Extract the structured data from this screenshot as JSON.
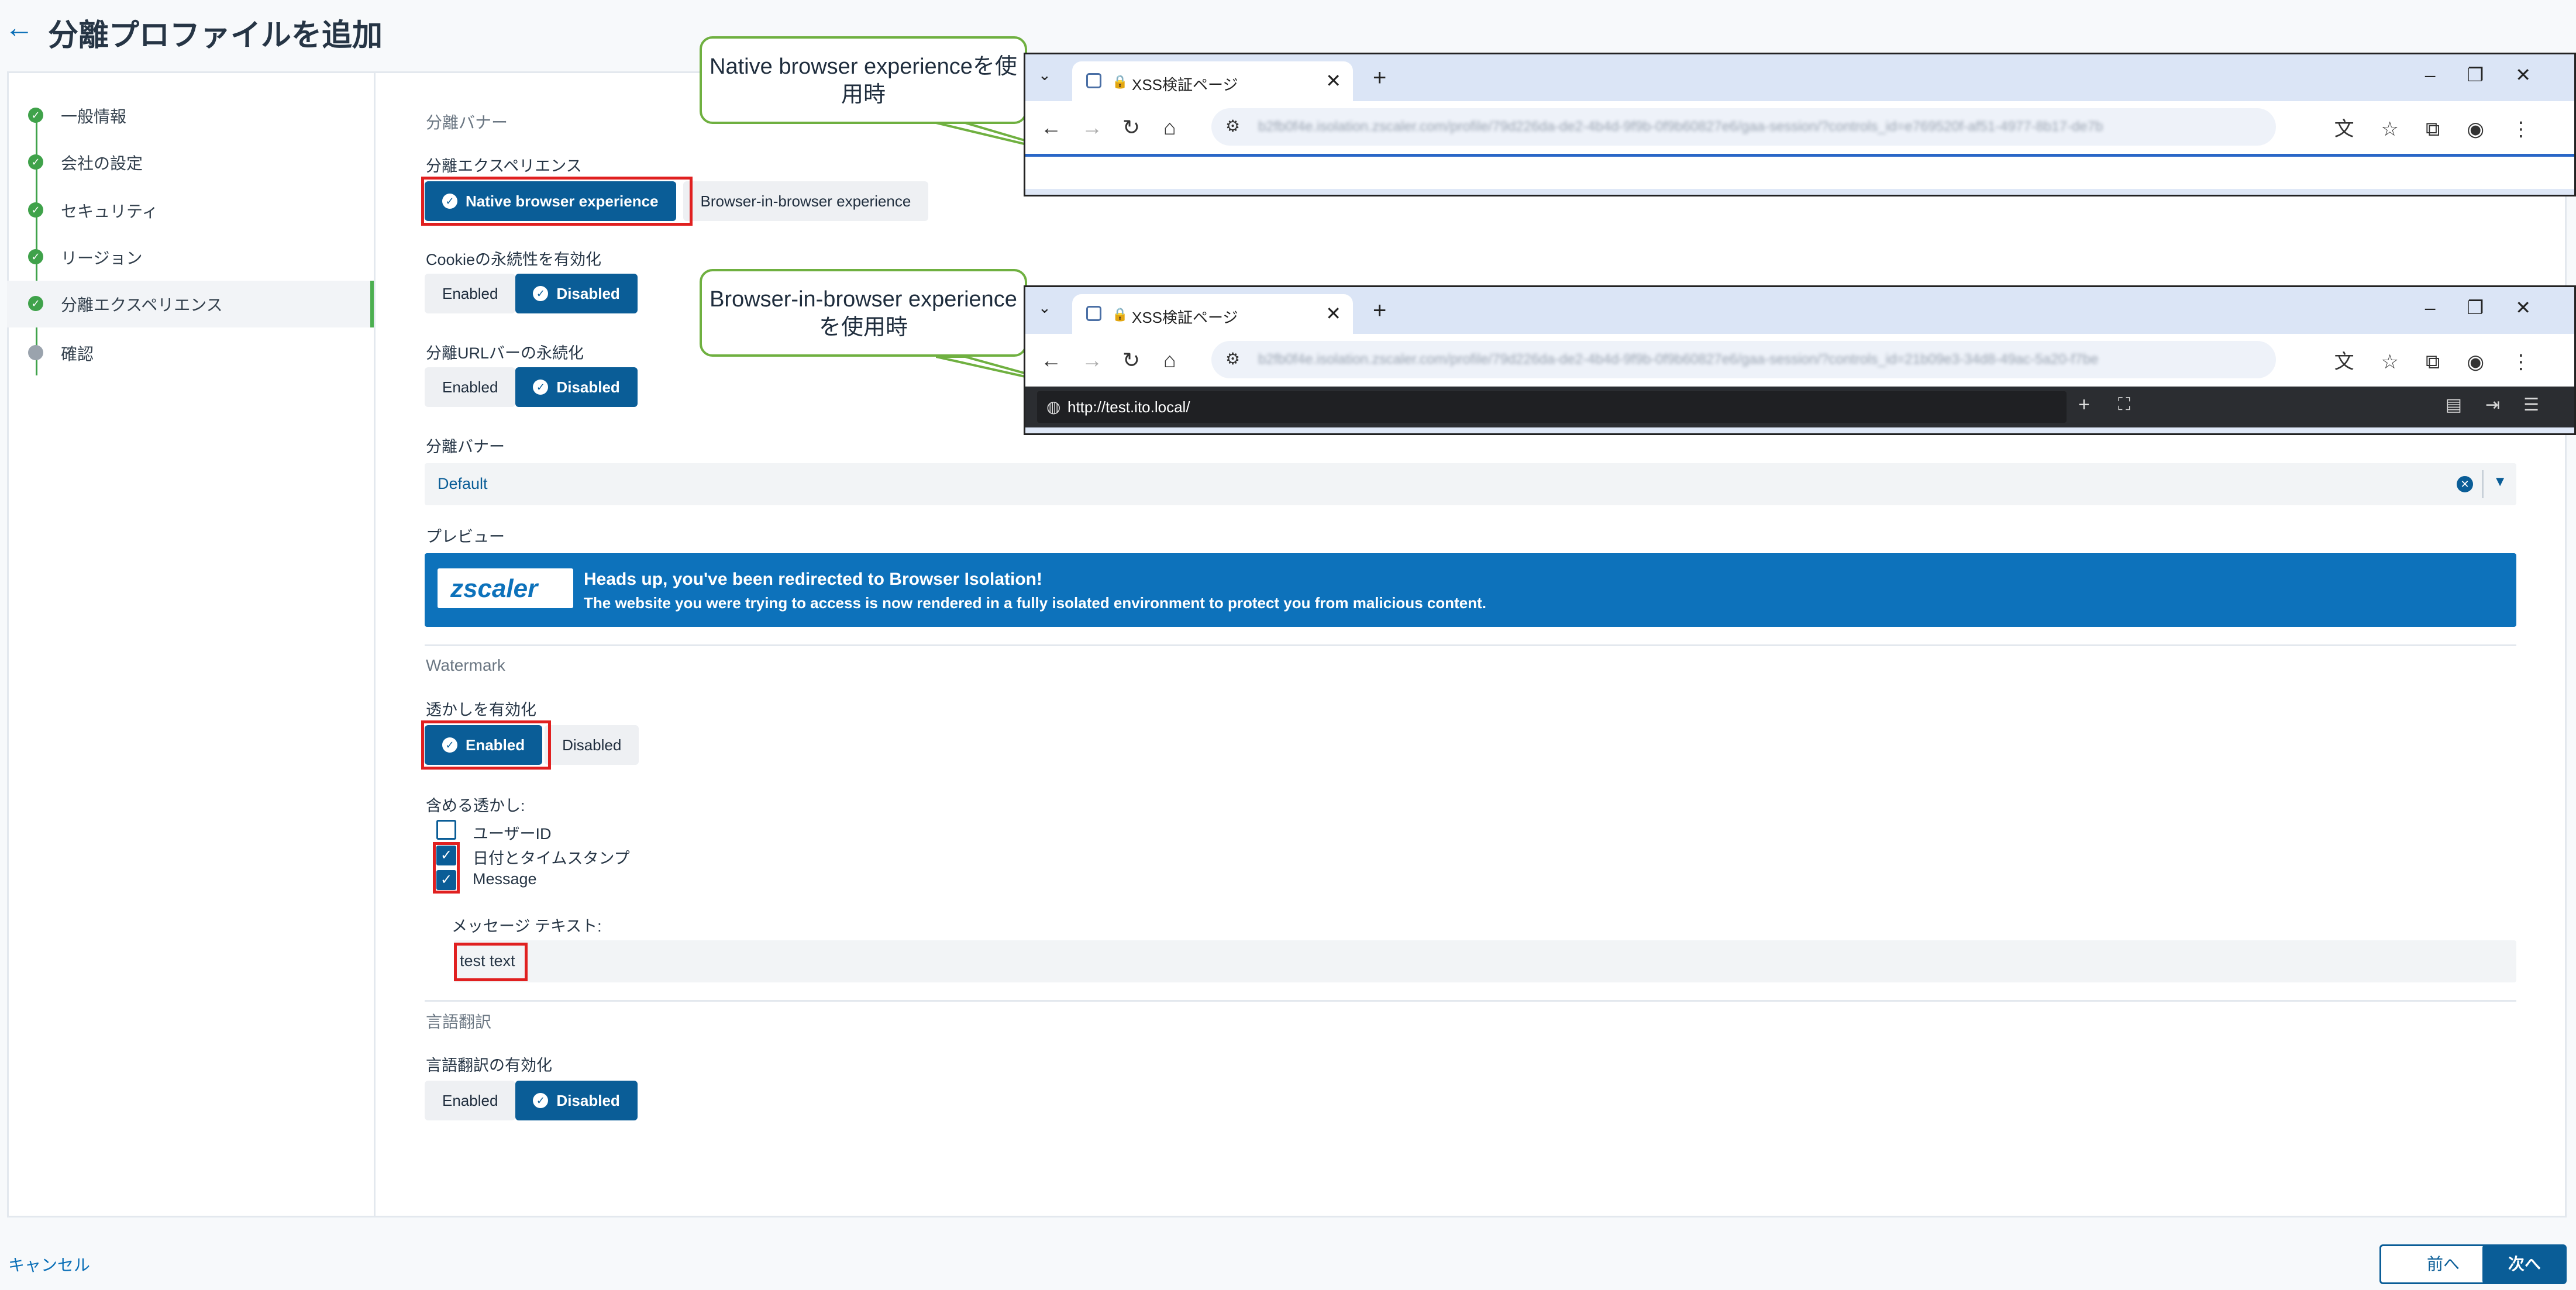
{
  "header": {
    "title": "分離プロファイルを追加"
  },
  "steps": [
    {
      "label": "一般情報",
      "done": true
    },
    {
      "label": "会社の設定",
      "done": true
    },
    {
      "label": "セキュリティ",
      "done": true
    },
    {
      "label": "リージョン",
      "done": true
    },
    {
      "label": "分離エクスペリエンス",
      "done": true
    },
    {
      "label": "確認",
      "done": false
    }
  ],
  "sections": {
    "banner_title": "分離バナー",
    "watermark_title": "Watermark",
    "translate_title": "言語翻訳"
  },
  "experience": {
    "label": "分離エクスペリエンス",
    "native": "Native browser experience",
    "bib": "Browser-in-browser experience"
  },
  "cookie": {
    "label": "Cookieの永続性を有効化",
    "enabled": "Enabled",
    "disabled": "Disabled"
  },
  "urlbar": {
    "label": "分離URLバーの永続化",
    "enabled": "Enabled",
    "disabled": "Disabled"
  },
  "banner_select": {
    "label": "分離バナー",
    "value": "Default"
  },
  "preview": {
    "label": "プレビュー",
    "logo": "zscaler",
    "line1": "Heads up, you've been redirected to Browser Isolation!",
    "line2": "The website you were trying to access is now rendered in a fully isolated environment to protect you from malicious content."
  },
  "watermark": {
    "label": "透かしを有効化",
    "enabled": "Enabled",
    "disabled": "Disabled",
    "include_label": "含める透かし:",
    "options": [
      {
        "label": "ユーザーID",
        "checked": false
      },
      {
        "label": "日付とタイムスタンプ",
        "checked": true
      },
      {
        "label": "Message",
        "checked": true
      }
    ],
    "message_label": "メッセージ テキスト:",
    "message_value": "test text"
  },
  "translate": {
    "label": "言語翻訳の有効化",
    "enabled": "Enabled",
    "disabled": "Disabled"
  },
  "footer": {
    "cancel": "キャンセル",
    "prev": "前へ",
    "next": "次へ"
  },
  "callouts": {
    "native": "Native browser experienceを使用時",
    "bib": "Browser-in-browser experienceを使用時"
  },
  "browser": {
    "tab_title": "XSS検証ページ",
    "blurred_url_1": "b2fb0f4e.isolation.zscaler.com/profile/79d226da-de2-4b4d-9f9b-0f9b60827e6/gaa-session/?controls_id=e769520f-af51-4977-8b17-de7b",
    "blurred_url_2": "b2fb0f4e.isolation.zscaler.com/profile/79d226da-de2-4b4d-9f9b-0f9b60827e6/gaa-session/?controls_id=21b09e3-34d8-49ac-5a20-f7be",
    "iso_url": "http://test.ito.local/"
  },
  "colors": {
    "primary": "#0a5d97",
    "banner": "#0d72bb",
    "success": "#3fa24a",
    "highlight": "#e02020",
    "callout_border": "#6fb040"
  }
}
